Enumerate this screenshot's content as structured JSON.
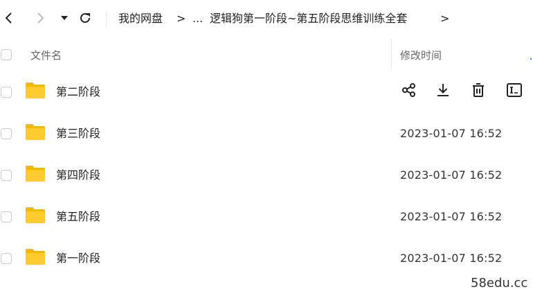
{
  "nav": {
    "breadcrumb": [
      "我的网盘",
      "...",
      "逻辑狗第一阶段~第五阶段思维训练全套"
    ],
    "separator": ">"
  },
  "table": {
    "columns": {
      "name": "文件名",
      "modified": "修改时间"
    },
    "rows": [
      {
        "name": "第二阶段",
        "modified": "",
        "hovered": true
      },
      {
        "name": "第三阶段",
        "modified": "2023-01-07 16:52"
      },
      {
        "name": "第四阶段",
        "modified": "2023-01-07 16:52"
      },
      {
        "name": "第五阶段",
        "modified": "2023-01-07 16:52"
      },
      {
        "name": "第一阶段",
        "modified": "2023-01-07 16:52"
      }
    ],
    "row_actions": [
      "share-icon",
      "download-icon",
      "delete-icon",
      "rename-icon"
    ]
  },
  "watermark": "58edu.cc",
  "colors": {
    "folder": "#FFCB2F",
    "folder_tab": "#F5B800",
    "checkbox_border": "#c9c9c9",
    "text": "#222222"
  }
}
